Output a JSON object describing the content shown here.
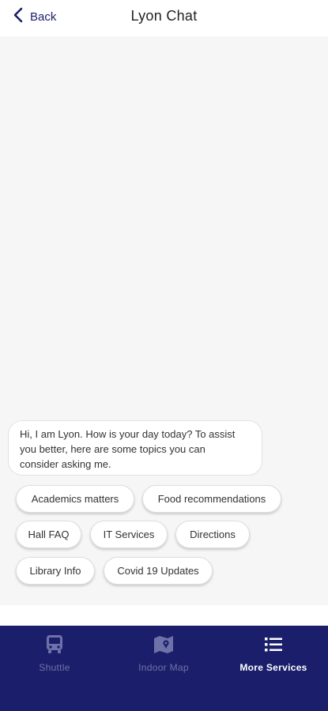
{
  "header": {
    "back_label": "Back",
    "title": "Lyon Chat"
  },
  "chat": {
    "bot_message_lines": [
      "Hi, I am Lyon. How is your day today? To assist",
      "you better, here are some topics you can",
      "consider asking me."
    ],
    "suggestions": [
      "Academics matters",
      "Food recommendations",
      "Hall FAQ",
      "IT Services",
      "Directions",
      "Library Info",
      "Covid 19 Updates"
    ]
  },
  "tabbar": {
    "tabs": [
      {
        "label": "Shuttle",
        "icon": "bus-icon",
        "active": false
      },
      {
        "label": "Indoor Map",
        "icon": "map-icon",
        "active": false
      },
      {
        "label": "More Services",
        "icon": "list-icon",
        "active": true
      }
    ]
  },
  "colors": {
    "brand_navy": "#1b1f6b",
    "chat_background": "#f6f6f6",
    "inactive_tab": "#6f72a8"
  }
}
